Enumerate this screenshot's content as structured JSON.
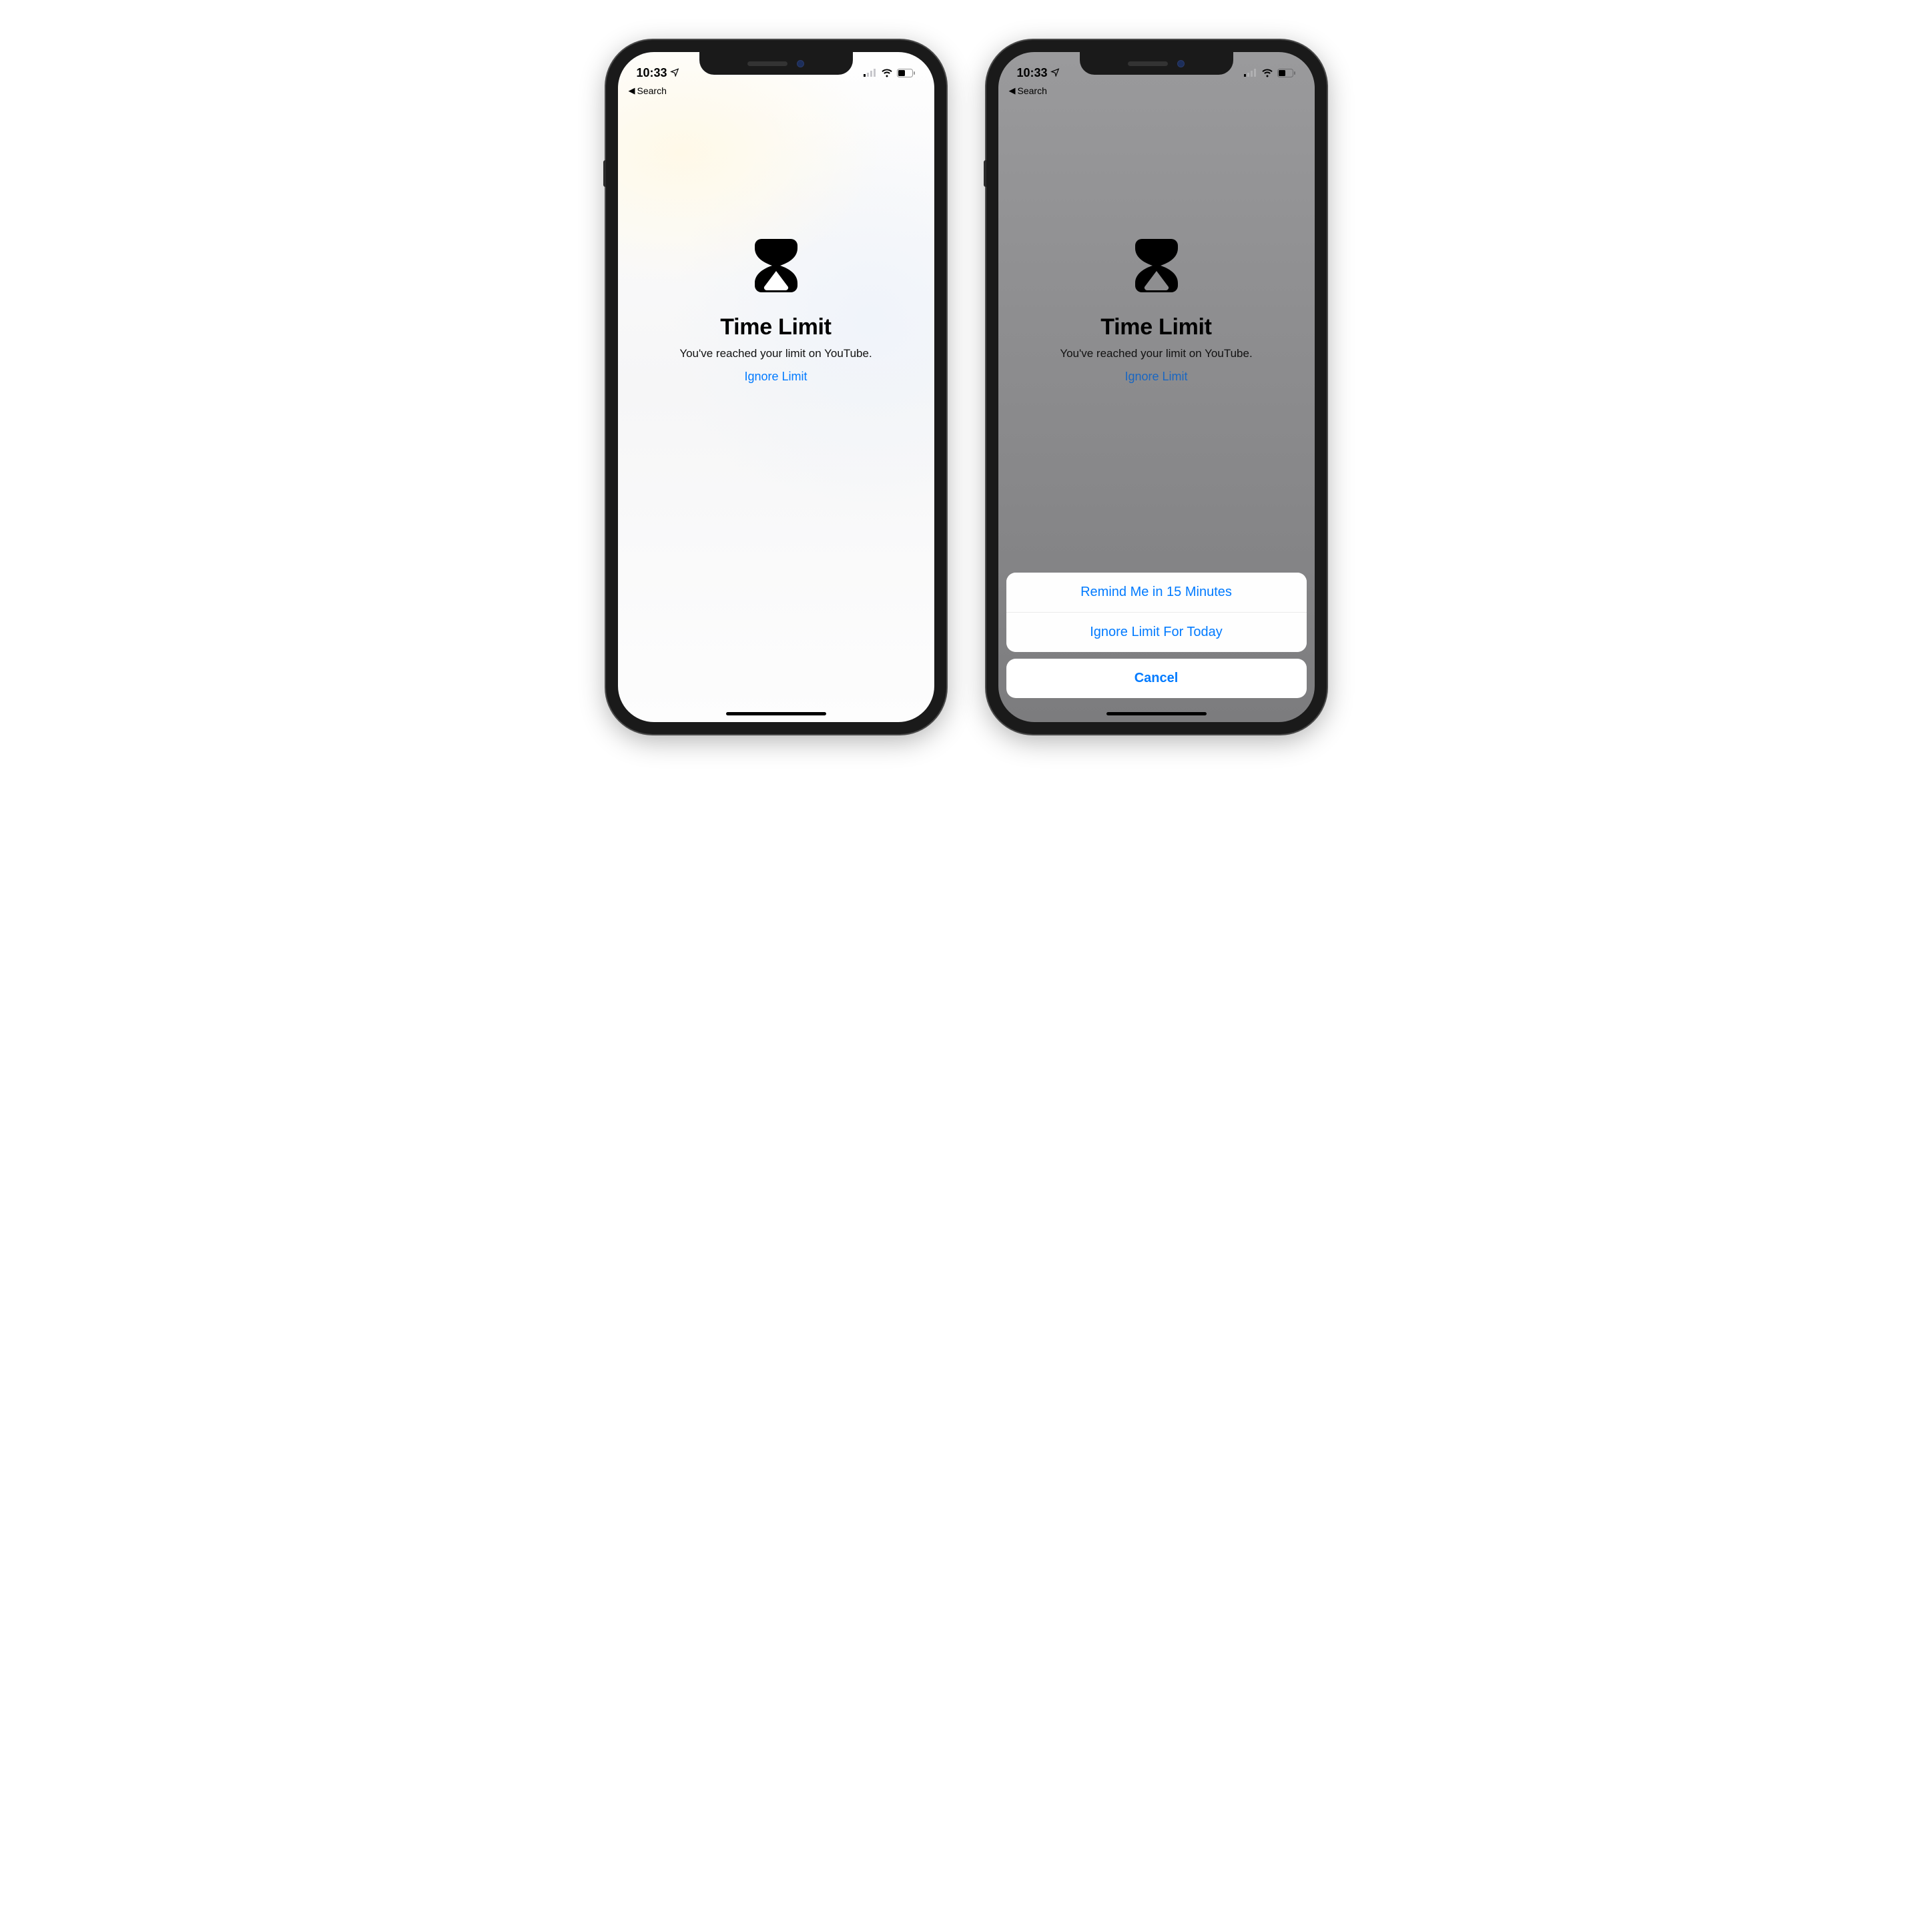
{
  "status": {
    "time": "10:33",
    "back_label": "Search"
  },
  "screen": {
    "title": "Time Limit",
    "subtitle": "You've reached your limit on YouTube.",
    "ignore_link": "Ignore Limit"
  },
  "action_sheet": {
    "option_remind": "Remind Me in 15 Minutes",
    "option_ignore_today": "Ignore Limit For Today",
    "cancel": "Cancel"
  }
}
